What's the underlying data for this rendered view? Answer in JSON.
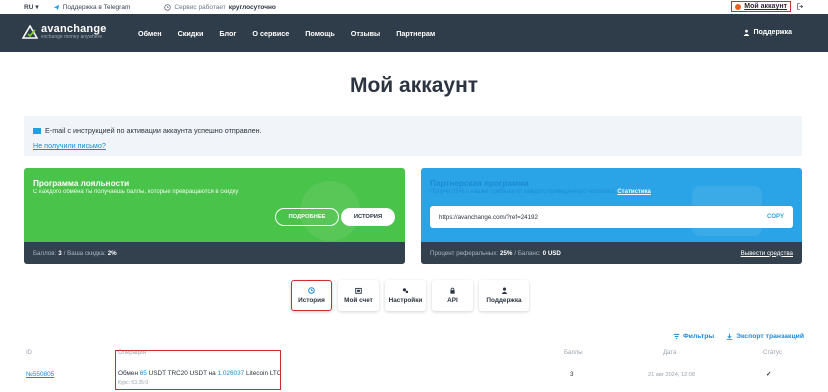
{
  "topbar": {
    "language": "RU",
    "telegram": "Поддержка в Telegram",
    "service_prefix": "Сервис работает",
    "service_status": "круглосуточно",
    "account": "Мой аккаунт"
  },
  "nav": {
    "logo_main": "avanchange",
    "logo_tagline": "exchange money anywhere",
    "menu": [
      "Обмен",
      "Скидки",
      "Блог",
      "О сервисе",
      "Помощь",
      "Отзывы",
      "Партнерам"
    ],
    "support": "Поддержка"
  },
  "page_title": "Мой аккаунт",
  "notice": {
    "message": "E-mail с инструкцией по активации аккаунта успешно отправлен.",
    "resend": "Не получили письмо?"
  },
  "loyalty": {
    "title": "Программа лояльности",
    "desc": "С каждого обмена ты получаешь баллы, которые превращаются в скидку",
    "more_button": "ПОДРОБНЕЕ",
    "history_button": "ИСТОРИЯ",
    "points_label": "Баллов:",
    "points_value": "3",
    "discount_label": "/ Ваша скидка:",
    "discount_value": "2%"
  },
  "partner": {
    "title": "Партнерская программа",
    "desc": "Получи 25% с нашей прибыли от каждого приведенного человека.",
    "stats_link": "Статистика",
    "ref_link": "https://avanchange.com/?ref=24192",
    "copy": "COPY",
    "percent_label": "Процент реферальных:",
    "percent_value": "25%",
    "balance_label": "/ Баланс:",
    "balance_value": "0 USD",
    "withdraw": "Вывести средства"
  },
  "tabs": [
    {
      "label": "История",
      "icon": "clock-icon"
    },
    {
      "label": "Мой счет",
      "icon": "wallet-icon"
    },
    {
      "label": "Настройки",
      "icon": "gears-icon"
    },
    {
      "label": "API",
      "icon": "lock-icon"
    },
    {
      "label": "Поддержка",
      "icon": "support-icon"
    }
  ],
  "actions": {
    "filters": "Фильтры",
    "export": "Экспорт транзакций"
  },
  "table": {
    "headers": {
      "id": "ID",
      "operation": "Операция",
      "points": "Баллы",
      "date": "Дата",
      "status": "Статус"
    },
    "rows": [
      {
        "id": "№550805",
        "op_prefix": "Обмен",
        "op_amount1": "65",
        "op_mid": "USDT TRC20 USDT на",
        "op_amount2": "1.026037",
        "op_suffix": "Litecoin LTC",
        "rate": "Курс: 63.35:0",
        "points": "3",
        "date": "21 авг 2024, 12:08",
        "status": "✓"
      }
    ]
  },
  "colors": {
    "nav_bg": "#2f3d4a",
    "loyalty_green": "#4ac34a",
    "partner_blue": "#2aa4e6",
    "link_blue": "#1d8ad6",
    "highlight_red": "#d42b2b"
  }
}
